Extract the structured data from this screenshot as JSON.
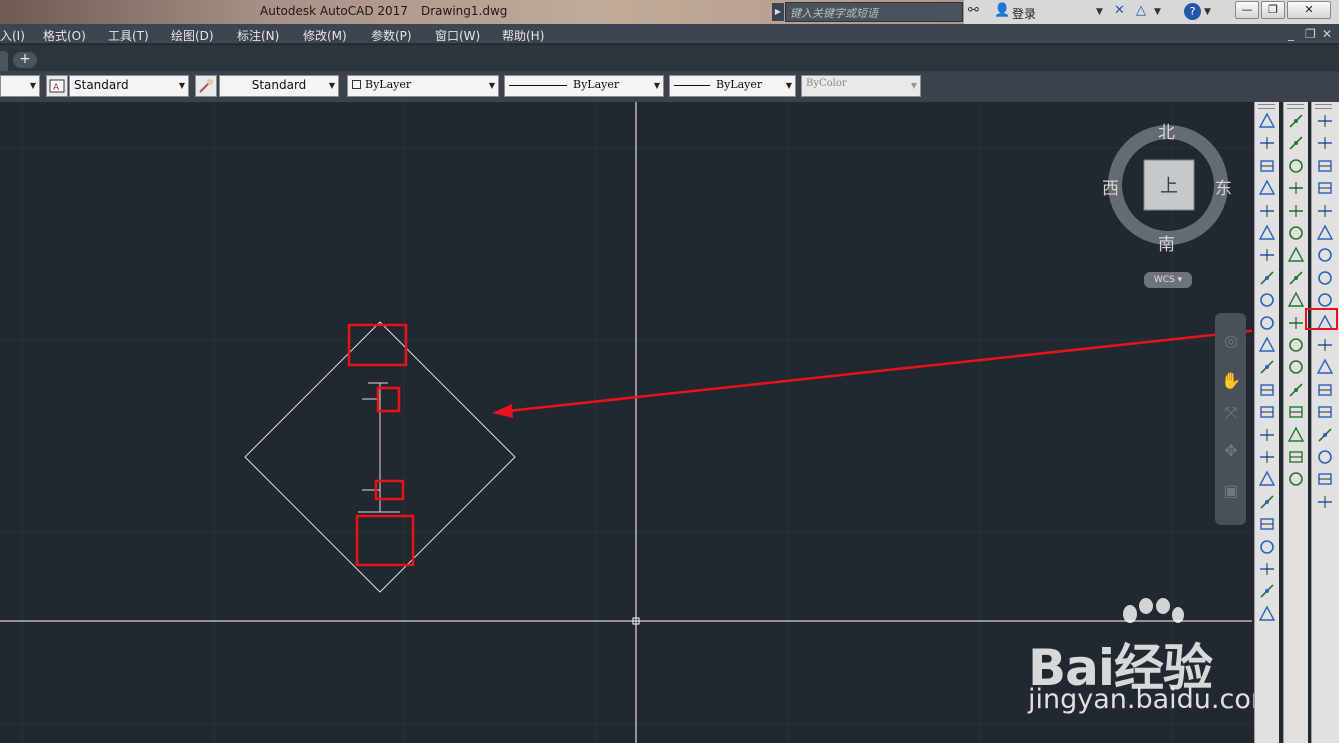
{
  "window": {
    "title": "Autodesk AutoCAD 2017",
    "document": "Drawing1.dwg",
    "search_placeholder": "键入关键字或短语",
    "login": "登录"
  },
  "menus": [
    "入(I)",
    "格式(O)",
    "工具(T)",
    "绘图(D)",
    "标注(N)",
    "修改(M)",
    "参数(P)",
    "窗口(W)",
    "帮助(H)"
  ],
  "tabbar": {
    "add_label": "+"
  },
  "properties": {
    "text_style": "Standard",
    "dim_style": "Standard",
    "color": "ByLayer",
    "linetype": "ByLayer",
    "lineweight": "ByLayer",
    "plot_style": "ByColor"
  },
  "viewcube": {
    "north": "北",
    "south": "南",
    "east": "东",
    "west": "西",
    "face": "上",
    "wcs": "WCS"
  },
  "watermark": {
    "brand": "Bai经验",
    "url": "jingyan.baidu.com"
  },
  "colors": {
    "canvas": "#212830",
    "annotation": "#e8121b",
    "drawing_lines": "#d9d9d9",
    "crosshair": "#ffffff"
  },
  "icons": {
    "dimension_toolbar": [
      "linear-dim-icon",
      "aligned-dim-icon",
      "arc-length-icon",
      "ordinate-icon",
      "radius-icon",
      "jogged-icon",
      "diameter-icon",
      "angular-icon",
      "quick-dim-icon",
      "baseline-icon",
      "continue-icon",
      "spacing-icon",
      "break-icon",
      "tolerance-icon",
      "center-mark-icon",
      "inspect-icon",
      "jogged-linear-icon",
      "dimedit-icon",
      "dimtedit-icon",
      "dimstyle-icon",
      "text-icon",
      "leader-icon",
      "list-icon"
    ],
    "snap_toolbar": [
      "temp-track-icon",
      "from-icon",
      "endpoint-icon",
      "midpoint-icon",
      "intersection-icon",
      "apparent-int-icon",
      "extension-icon",
      "center-icon",
      "quadrant-icon",
      "tangent-icon",
      "perpendicular-icon",
      "parallel-icon",
      "insert-icon",
      "node-icon",
      "nearest-icon",
      "none-icon",
      "snap-settings-icon"
    ],
    "modify_toolbar": [
      "erase-icon",
      "copy-icon",
      "mirror-icon",
      "offset-icon",
      "array-icon",
      "move-icon",
      "rotate-icon",
      "scale-icon",
      "stretch-icon",
      "trim-icon",
      "extend-icon",
      "break-at-point-icon",
      "break-icon",
      "join-icon",
      "chamfer-icon",
      "fillet-icon",
      "blend-icon",
      "explode-icon"
    ]
  }
}
